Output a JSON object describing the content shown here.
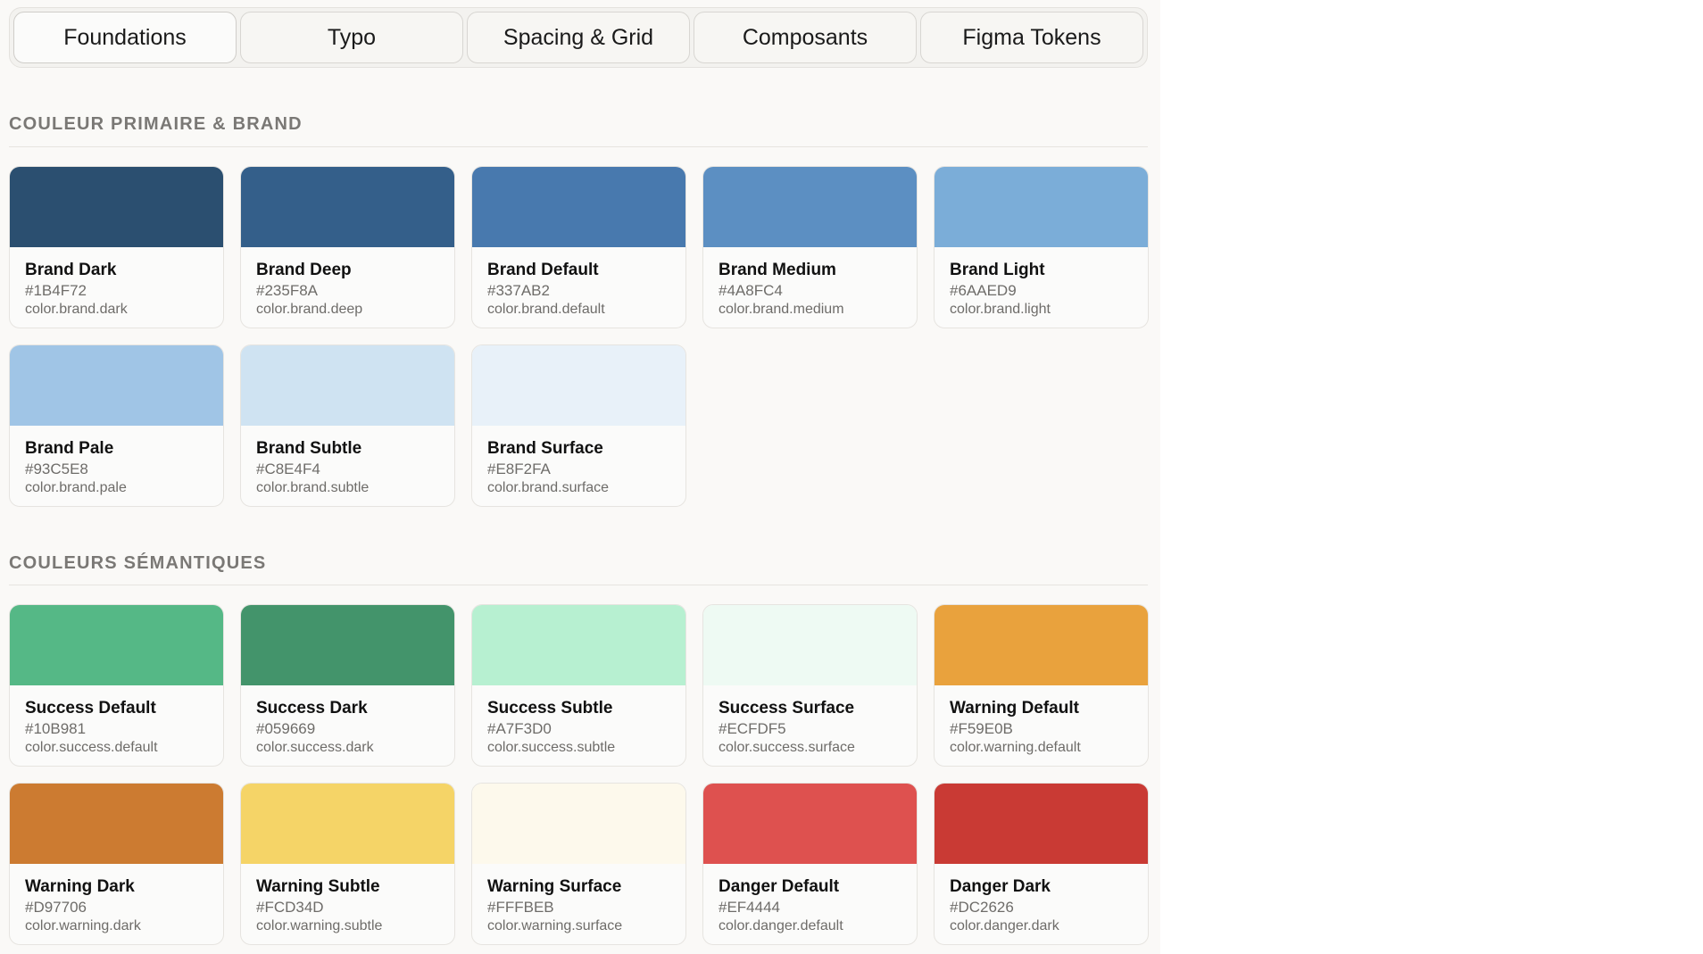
{
  "tabs": [
    {
      "label": "Foundations",
      "active": true
    },
    {
      "label": "Typo",
      "active": false
    },
    {
      "label": "Spacing & Grid",
      "active": false
    },
    {
      "label": "Composants",
      "active": false
    },
    {
      "label": "Figma Tokens",
      "active": false
    }
  ],
  "sections": {
    "brand": {
      "title": "COULEUR PRIMAIRE & BRAND",
      "swatches": [
        {
          "name": "Brand Dark",
          "hex": "#1B4F72",
          "token": "color.brand.dark",
          "color": "#2b4f70"
        },
        {
          "name": "Brand Deep",
          "hex": "#235F8A",
          "token": "color.brand.deep",
          "color": "#345f8a"
        },
        {
          "name": "Brand Default",
          "hex": "#337AB2",
          "token": "color.brand.default",
          "color": "#4879ae"
        },
        {
          "name": "Brand Medium",
          "hex": "#4A8FC4",
          "token": "color.brand.medium",
          "color": "#5c8fc2"
        },
        {
          "name": "Brand Light",
          "hex": "#6AAED9",
          "token": "color.brand.light",
          "color": "#7badd8"
        },
        {
          "name": "Brand Pale",
          "hex": "#93C5E8",
          "token": "color.brand.pale",
          "color": "#a0c5e6"
        },
        {
          "name": "Brand Subtle",
          "hex": "#C8E4F4",
          "token": "color.brand.subtle",
          "color": "#cfe3f2"
        },
        {
          "name": "Brand Surface",
          "hex": "#E8F2FA",
          "token": "color.brand.surface",
          "color": "#e8f1f9"
        }
      ]
    },
    "semantic": {
      "title": "COULEURS SÉMANTIQUES",
      "swatches": [
        {
          "name": "Success Default",
          "hex": "#10B981",
          "token": "color.success.default",
          "color": "#55b886"
        },
        {
          "name": "Success Dark",
          "hex": "#059669",
          "token": "color.success.dark",
          "color": "#43946b"
        },
        {
          "name": "Success Subtle",
          "hex": "#A7F3D0",
          "token": "color.success.subtle",
          "color": "#b7f0d1"
        },
        {
          "name": "Success Surface",
          "hex": "#ECFDF5",
          "token": "color.success.surface",
          "color": "#eefaf3"
        },
        {
          "name": "Warning Default",
          "hex": "#F59E0B",
          "token": "color.warning.default",
          "color": "#e9a23d"
        },
        {
          "name": "Warning Dark",
          "hex": "#D97706",
          "token": "color.warning.dark",
          "color": "#cc7b31"
        },
        {
          "name": "Warning Subtle",
          "hex": "#FCD34D",
          "token": "color.warning.subtle",
          "color": "#f5d467"
        },
        {
          "name": "Warning Surface",
          "hex": "#FFFBEB",
          "token": "color.warning.surface",
          "color": "#fdf9ec"
        },
        {
          "name": "Danger Default",
          "hex": "#EF4444",
          "token": "color.danger.default",
          "color": "#de514f"
        },
        {
          "name": "Danger Dark",
          "hex": "#DC2626",
          "token": "color.danger.dark",
          "color": "#c93a34"
        }
      ]
    }
  }
}
